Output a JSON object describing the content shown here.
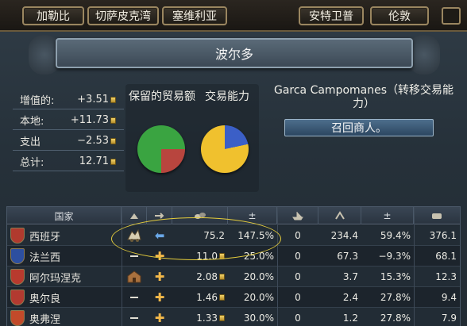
{
  "tabs": [
    "加勒比",
    "切萨皮克湾",
    "塞维利亚",
    "安特卫普",
    "伦敦"
  ],
  "title": "波尔多",
  "stats": [
    {
      "label": "增值的:",
      "value": "+3.51"
    },
    {
      "label": "本地:",
      "value": "+11.73"
    },
    {
      "label": "支出",
      "value": "−2.53"
    },
    {
      "label": "总计:",
      "value": "12.71"
    }
  ],
  "pies": {
    "retained_label": "保留的贸易额",
    "trade_power_label": "交易能力",
    "retained_colors": {
      "main": "#3aa441",
      "slice": "#b8453e"
    },
    "trade_power_colors": {
      "main": "#f0c12e",
      "slice": "#3b5fc7"
    }
  },
  "merchant": {
    "text": "Garca Campomanes（转移交易能力）",
    "button": "召回商人。"
  },
  "table": {
    "header": {
      "country": "国家",
      "col_total": "±",
      "col_pct": "±"
    },
    "rows": [
      {
        "name": "西班牙",
        "shield_color": "#b03a2e",
        "icon": "merchant",
        "action": "arrow",
        "value": "75.2",
        "pct1": "147.5%",
        "ships": "0",
        "power": "234.4",
        "pct2": "59.4%",
        "last": "376.1"
      },
      {
        "name": "法兰西",
        "shield_color": "#2d4fa0",
        "icon": "dash",
        "action": "plus",
        "value": "11.0",
        "pct1": "25.0%",
        "ships": "0",
        "power": "67.3",
        "pct2": "−9.3%",
        "last": "68.1"
      },
      {
        "name": "阿尔玛涅克",
        "shield_color": "#b83a2e",
        "icon": "building",
        "action": "plus",
        "value": "2.08",
        "pct1": "20.0%",
        "ships": "0",
        "power": "3.7",
        "pct2": "15.3%",
        "last": "12.3"
      },
      {
        "name": "奥尔良",
        "shield_color": "#b33a30",
        "icon": "dash",
        "action": "plus",
        "value": "1.46",
        "pct1": "20.0%",
        "ships": "0",
        "power": "2.4",
        "pct2": "27.8%",
        "last": "9.4"
      },
      {
        "name": "奥弗涅",
        "shield_color": "#c24a2a",
        "icon": "dash",
        "action": "plus",
        "value": "1.33",
        "pct1": "30.0%",
        "ships": "0",
        "power": "1.2",
        "pct2": "27.8%",
        "last": "7.9"
      }
    ]
  }
}
